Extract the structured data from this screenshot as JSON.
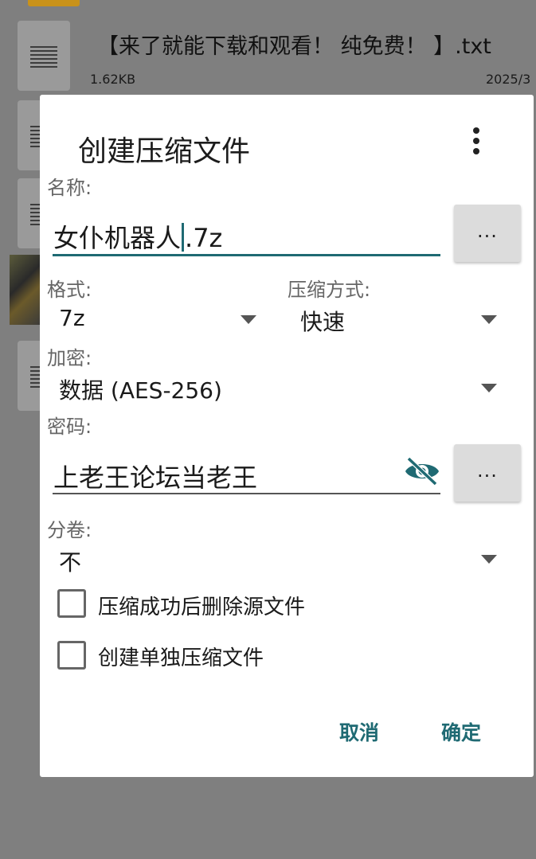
{
  "background": {
    "file_title": "【来了就能下载和观看！ 纯免费！ 】.txt",
    "file_size": "1.62KB",
    "file_date": "2025/3"
  },
  "dialog": {
    "title": "创建压缩文件",
    "name_label": "名称:",
    "name_before_caret": "女仆机器人",
    "name_after_caret": ".7z",
    "browse_label": "...",
    "format_label": "格式:",
    "format_value": "7z",
    "method_label": "压缩方式:",
    "method_value": "快速",
    "encryption_label": "加密:",
    "encryption_value": "数据 (AES-256)",
    "password_label": "密码:",
    "password_value": "上老王论坛当老王",
    "password_more_label": "...",
    "volume_label": "分卷:",
    "volume_value": "不",
    "delete_source_label": "压缩成功后删除源文件",
    "delete_source_checked": false,
    "separate_archive_label": "创建单独压缩文件",
    "separate_archive_checked": false,
    "cancel_label": "取消",
    "ok_label": "确定"
  },
  "colors": {
    "accent": "#1f6a73",
    "scrim": "#7f7f7f"
  },
  "icons": {
    "more": "more-vert-icon",
    "dropdown": "dropdown-arrow-icon",
    "visibility": "visibility-off-icon"
  }
}
